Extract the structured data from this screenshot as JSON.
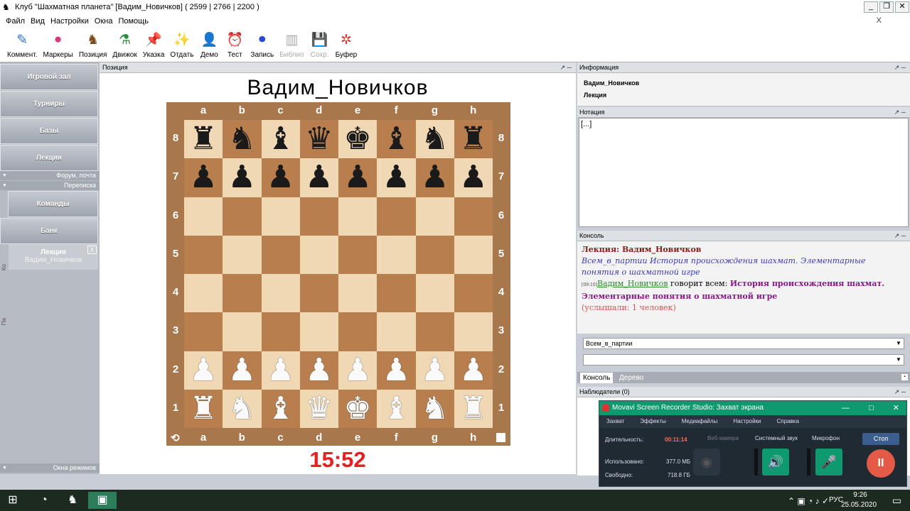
{
  "window": {
    "title": "Клуб \"Шахматная планета\" [Вадим_Новичков]  ( 2599 | 2766 | 2200 )"
  },
  "menu": [
    "Файл",
    "Вид",
    "Настройки",
    "Окна",
    "Помощь"
  ],
  "menu_close": "X",
  "toolbar": [
    {
      "label": "Коммент.",
      "icon": "pencil-icon",
      "glyph": "✎",
      "color": "#2a6fd6"
    },
    {
      "label": "Маркеры",
      "icon": "markers-icon",
      "glyph": "●",
      "color": "#d63a7a"
    },
    {
      "label": "Позиция",
      "icon": "position-icon",
      "glyph": "♞",
      "color": "#7a4a1a"
    },
    {
      "label": "Движок",
      "icon": "engine-icon",
      "glyph": "⚗",
      "color": "#2a8a3a"
    },
    {
      "label": "Указка",
      "icon": "pointer-icon",
      "glyph": "📌",
      "color": "#d92a2a"
    },
    {
      "label": "Отдать",
      "icon": "wand-icon",
      "glyph": "✨",
      "color": "#d9a52a"
    },
    {
      "label": "Демо",
      "icon": "demo-icon",
      "glyph": "👤",
      "color": "#333"
    },
    {
      "label": "Тест",
      "icon": "clock-icon",
      "glyph": "⏰",
      "color": "#2a5ad6"
    },
    {
      "label": "Запись",
      "icon": "record-icon",
      "glyph": "⏺",
      "color": "#2a4ad6"
    },
    {
      "label": "Библио",
      "icon": "library-icon",
      "glyph": "▥",
      "color": "#aaa",
      "disabled": true
    },
    {
      "label": "Сохр.",
      "icon": "save-icon",
      "glyph": "💾",
      "color": "#aaa",
      "disabled": true
    },
    {
      "label": "Буфер",
      "icon": "puzzle-icon",
      "glyph": "✲",
      "color": "#d63a3a"
    }
  ],
  "left": {
    "buttons": [
      "Игровой зал",
      "Турниры",
      "Базы",
      "Лекции"
    ],
    "section1": "Форум, почта",
    "section2": "Переписка",
    "buttons2": [
      "Команды",
      "Банк"
    ],
    "side_tab1": "Ко",
    "side_tab2": "Па",
    "lecture": {
      "title": "Лекция",
      "author": "Вадим_Новичков",
      "close": "X"
    },
    "bottom": "Окна режимов"
  },
  "position": {
    "header": "Позиция",
    "player": "Вадим_Новичков",
    "clock": "15:52",
    "files": [
      "a",
      "b",
      "c",
      "d",
      "e",
      "f",
      "g",
      "h"
    ],
    "ranks": [
      "8",
      "7",
      "6",
      "5",
      "4",
      "3",
      "2",
      "1"
    ],
    "board": [
      "rnbqkbnr",
      "pppppppp",
      "........",
      "........",
      "........",
      "........",
      "PPPPPPPP",
      "RNBQKBNR"
    ],
    "flip_icon": "⟲"
  },
  "info": {
    "header": "Информация",
    "name": "Вадим_Новичков",
    "type": "Лекция"
  },
  "notation": {
    "header": "Нотация",
    "text": "[...]"
  },
  "console": {
    "header": "Консоль",
    "line1": "Лекция: Вадим_Новичков",
    "line2": "Всем_в_партии История происхождения шахмат. Элементарные понятия о шахматной игре",
    "timestamp": "[09:10]",
    "sender": "Вадим_Новичков",
    "says": " говорит всем: ",
    "message": "История происхождения шахмат. Элементарные понятия о шахматной игре",
    "heard": "(услышали: 1 человек)",
    "target": "Всем_в_партии",
    "tabs": [
      "Консоль",
      "Дерево"
    ]
  },
  "observers": {
    "header": "Наблюдатели (0)"
  },
  "movavi": {
    "title": "Movavi Screen Recorder Studio: Захват экрана",
    "controls": [
      "—",
      "□",
      "✕"
    ],
    "menu": [
      "Захват",
      "Эффекты",
      "Медиафайлы",
      "Настройки",
      "Справка"
    ],
    "duration_label": "Длительность:",
    "duration": "00:11:14",
    "used_label": "Использовано:",
    "used": "377.0 МБ",
    "free_label": "Свободно:",
    "free": "718.8 ГБ",
    "webcam": "Веб-камера",
    "system_audio": "Системный звук",
    "mic": "Микрофон",
    "stop": "Стоп",
    "pause_glyph": "II"
  },
  "taskbar": {
    "lang": "РУС",
    "time": "9:26",
    "date": "25.05.2020"
  }
}
